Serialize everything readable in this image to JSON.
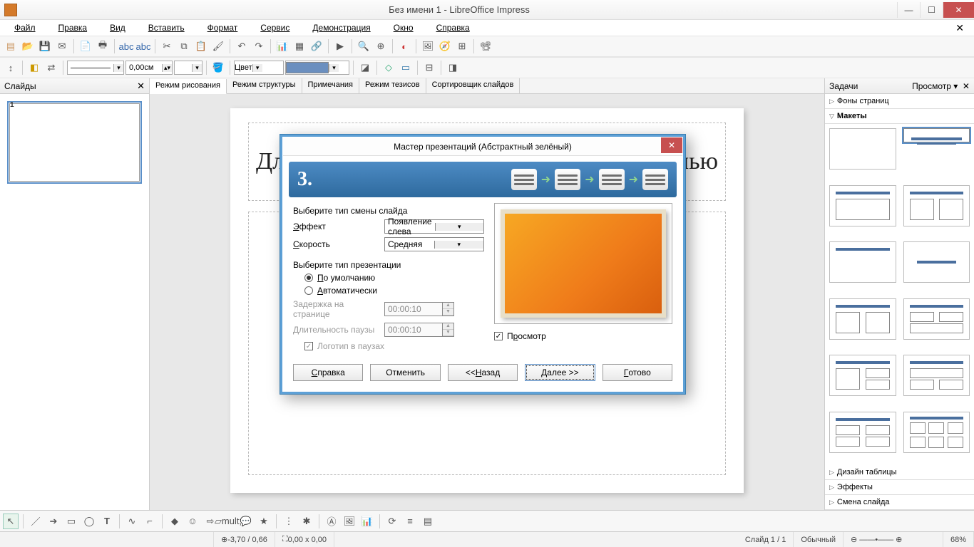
{
  "window": {
    "title": "Без имени 1 - LibreOffice Impress"
  },
  "menu": {
    "items": [
      "Файл",
      "Правка",
      "Вид",
      "Вставить",
      "Формат",
      "Сервис",
      "Демонстрация",
      "Окно",
      "Справка"
    ]
  },
  "toolbar2": {
    "line_width": "0,00см",
    "fill_mode": "Цвет"
  },
  "slides_panel": {
    "title": "Слайды",
    "slide_numbers": [
      "1"
    ]
  },
  "view_tabs": [
    "Режим рисования",
    "Режим структуры",
    "Примечания",
    "Режим тезисов",
    "Сортировщик слайдов"
  ],
  "slide": {
    "title_placeholder": "Для добавления заголовка щелкните мышью"
  },
  "tasks": {
    "title": "Задачи",
    "view_label": "Просмотр",
    "sections": {
      "backgrounds": "Фоны страниц",
      "layouts": "Макеты",
      "table": "Дизайн таблицы",
      "effects": "Эффекты",
      "transition": "Смена слайда"
    }
  },
  "dialog": {
    "title": "Мастер презентаций (Абстрактный зелёный)",
    "step": "3.",
    "transition_label": "Выберите тип смены слайда",
    "effect_label": "Эффект",
    "effect_value": "Появление слева",
    "speed_label": "Скорость",
    "speed_value": "Средняя",
    "prestype_label": "Выберите тип презентации",
    "radio_default": "По умолчанию",
    "radio_auto": "Автоматически",
    "delay_label": "Задержка на странице",
    "delay_value": "00:00:10",
    "pause_label": "Длительность паузы",
    "pause_value": "00:00:10",
    "logo_label": "Логотип в паузах",
    "preview_label": "Просмотр",
    "buttons": {
      "help": "Справка",
      "cancel": "Отменить",
      "back": "<< Назад",
      "next": "Далее >>",
      "finish": "Готово"
    }
  },
  "status": {
    "coords": "-3,70 / 0,66",
    "size": "0,00 x 0,00",
    "slide": "Слайд 1 / 1",
    "mode": "Обычный",
    "zoom": "68%"
  }
}
